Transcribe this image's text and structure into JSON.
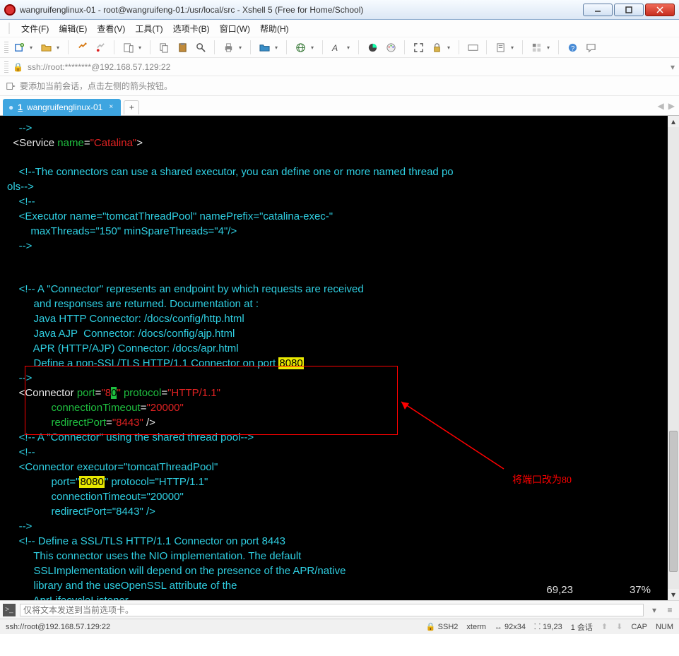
{
  "window": {
    "title": "wangruifenglinux-01 - root@wangruifeng-01:/usr/local/src - Xshell 5 (Free for Home/School)"
  },
  "menu": {
    "file": "文件(F)",
    "edit": "编辑(E)",
    "view": "查看(V)",
    "tools": "工具(T)",
    "tab": "选项卡(B)",
    "window": "窗口(W)",
    "help": "帮助(H)"
  },
  "address": "ssh://root:********@192.168.57.129:22",
  "hint": "要添加当前会话，点击左侧的箭头按钮。",
  "tab": {
    "index": "1",
    "name": "wangruifenglinux-01"
  },
  "vim": {
    "pos": "69,23",
    "pct": "37%"
  },
  "annot": "将端口改为80",
  "code": {
    "l1a": "    -->",
    "l2_open": "  <Service ",
    "l2_attr": "name",
    "l2_eq": "=",
    "l2_val": "\"Catalina\"",
    "l2_close": ">",
    "l3": "    <!--The connectors can use a shared executor, you can define one or more named thread po",
    "l3b": "ols-->",
    "l4": "    <!--",
    "l5": "    <Executor name=\"tomcatThreadPool\" namePrefix=\"catalina-exec-\"",
    "l6": "        maxThreads=\"150\" minSpareThreads=\"4\"/>",
    "l7": "    -->",
    "l8": "    <!-- A \"Connector\" represents an endpoint by which requests are received",
    "l9": "         and responses are returned. Documentation at :",
    "l10": "         Java HTTP Connector: /docs/config/http.html",
    "l11": "         Java AJP  Connector: /docs/config/ajp.html",
    "l12": "         APR (HTTP/AJP) Connector: /docs/apr.html",
    "l13a": "         Define a non-SSL/TLS HTTP/1.1 Connector on port ",
    "l13b": "8080",
    "l14": "    -->",
    "l15_open": "    <Connector ",
    "l15_port": "port",
    "l15_eq": "=",
    "l15_q1": "\"",
    "l15_8": "8",
    "l15_0": "0",
    "l15_q2": "\"",
    "l15_sp": " ",
    "l15_proto": "protocol",
    "l15_eq2": "=",
    "l15_pv": "\"HTTP/1.1\"",
    "l16_a": "               ",
    "l16_ct": "connectionTimeout",
    "l16_eq": "=",
    "l16_v": "\"20000\"",
    "l17_a": "               ",
    "l17_rp": "redirectPort",
    "l17_eq": "=",
    "l17_v": "\"8443\"",
    "l17_end": " />",
    "l18": "    <!-- A \"Connector\" using the shared thread pool-->",
    "l19": "    <!--",
    "l20": "    <Connector executor=\"tomcatThreadPool\"",
    "l21a": "               port=\"",
    "l21b": "8080",
    "l21c": "\" protocol=\"HTTP/1.1\"",
    "l22": "               connectionTimeout=\"20000\"",
    "l23": "               redirectPort=\"8443\" />",
    "l24": "    -->",
    "l25": "    <!-- Define a SSL/TLS HTTP/1.1 Connector on port 8443",
    "l26": "         This connector uses the NIO implementation. The default",
    "l27": "         SSLImplementation will depend on the presence of the APR/native",
    "l28": "         library and the useOpenSSL attribute of the",
    "l29": "         AprLifecycleListener."
  },
  "sendbar": {
    "placeholder": "仅将文本发送到当前选项卡。"
  },
  "status": {
    "left": "ssh://root@192.168.57.129:22",
    "ssh": "SSH2",
    "term": "xterm",
    "size": "92x34",
    "rc": "19,23",
    "sess": "1 会话",
    "cap": "CAP",
    "num": "NUM"
  }
}
